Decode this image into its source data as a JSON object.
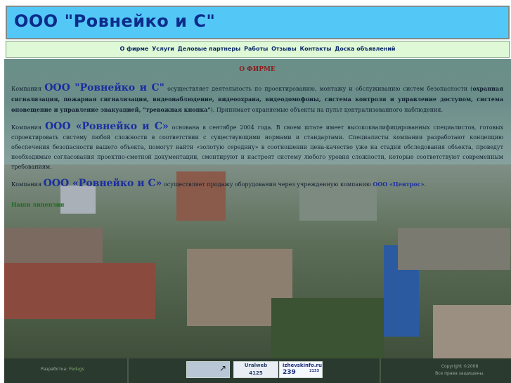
{
  "header": {
    "title": "ООО \"Ровнейко и С\""
  },
  "nav": {
    "items": [
      "О фирме",
      "Услуги",
      "Деловые партнеры",
      "Работы",
      "Отзывы",
      "Контакты",
      "Доска объявлений"
    ]
  },
  "main": {
    "section_title": "О ФИРМЕ",
    "p1": {
      "before": "Компания ",
      "company": "ООО \"Ровнейко и С\"",
      "mid": " осуществляет деятельность по проектированию, монтажу и обслуживанию систем безопасности (",
      "bold": "охранная сигнализация, пожарная сигнализация, видеонаблюдение, видеоохрана, видеодомофоны, система контроля и управление доступом, система оповещение и управление эвакуацией, \"тревожная кнопка\"",
      "after": "). Принимает охраняемые объекты на пульт централизованного наблюдения."
    },
    "p2": {
      "before": "Компания ",
      "company": "ООО «Ровнейко и С»",
      "after": " основана в сентябре 2004 года. В своем штате имеет высококвалифицированных специалистов, готовых спроектировать систему любой сложности в соответствии с существующими нормами и стандартами. Специалисты компании разработают концепцию обеспечения безопасности вашего объекта, помогут найти «золотую середину» в соотношении цена-качество уже на стадии обследования объекта, проведут необходимые согласования проектно-сметной документации, смонтируют и настроят систему любого уровня сложности, которые соответствуют современным требованиям."
    },
    "p3": {
      "before": "Компания ",
      "company": "ООО «Ровнейко и С»",
      "mid": " осуществляет продажу оборудования через учрежденную компанию ",
      "partner": "ООО «Центрос»",
      "after": "."
    },
    "licenses": "Наши лицензии"
  },
  "footer": {
    "dev_label": "Разработка:",
    "dev_name": "Pedugs",
    "counter1": "Uralweb",
    "counter1_value": "4125",
    "counter2": "izhevskinfo.ru",
    "counter2_value": "239",
    "counter2_small": "2133",
    "copyright": "Copyright ©2008",
    "rights": "Все права защищены."
  }
}
